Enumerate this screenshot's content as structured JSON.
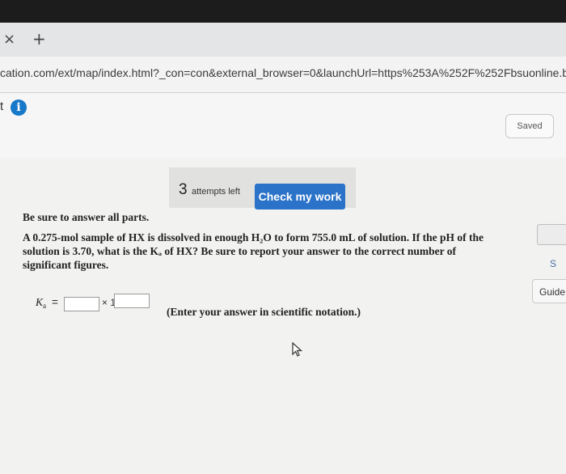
{
  "browser": {
    "tab_close": "×",
    "tab_add": "+",
    "url": "cation.com/ext/map/index.html?_con=con&external_browser=0&launchUrl=https%253A%252F%252Fbsuonline.blackboard"
  },
  "toolbar": {
    "crumb": "t",
    "info": "i",
    "saved": "Saved"
  },
  "attempts": {
    "count": "3",
    "label": "attempts left",
    "check_button": "Check my work"
  },
  "question": {
    "instruction": "Be sure to answer all parts.",
    "text": "A 0.275-mol sample of HX is dissolved in enough H₂O to form 755.0 mL of solution. If the pH of the solution is 3.70, what is the Kₐ of HX? Be sure to report your answer to the correct number of significant figures.",
    "ka_symbol": "K",
    "ka_sub": "a",
    "equals": "=",
    "mantissa_value": "",
    "times_ten": "× 10",
    "exponent_value": "",
    "hint": "(Enter your answer in scientific notation.)"
  },
  "sidebar": {
    "s_label": "S",
    "guide_label": "Guide"
  }
}
